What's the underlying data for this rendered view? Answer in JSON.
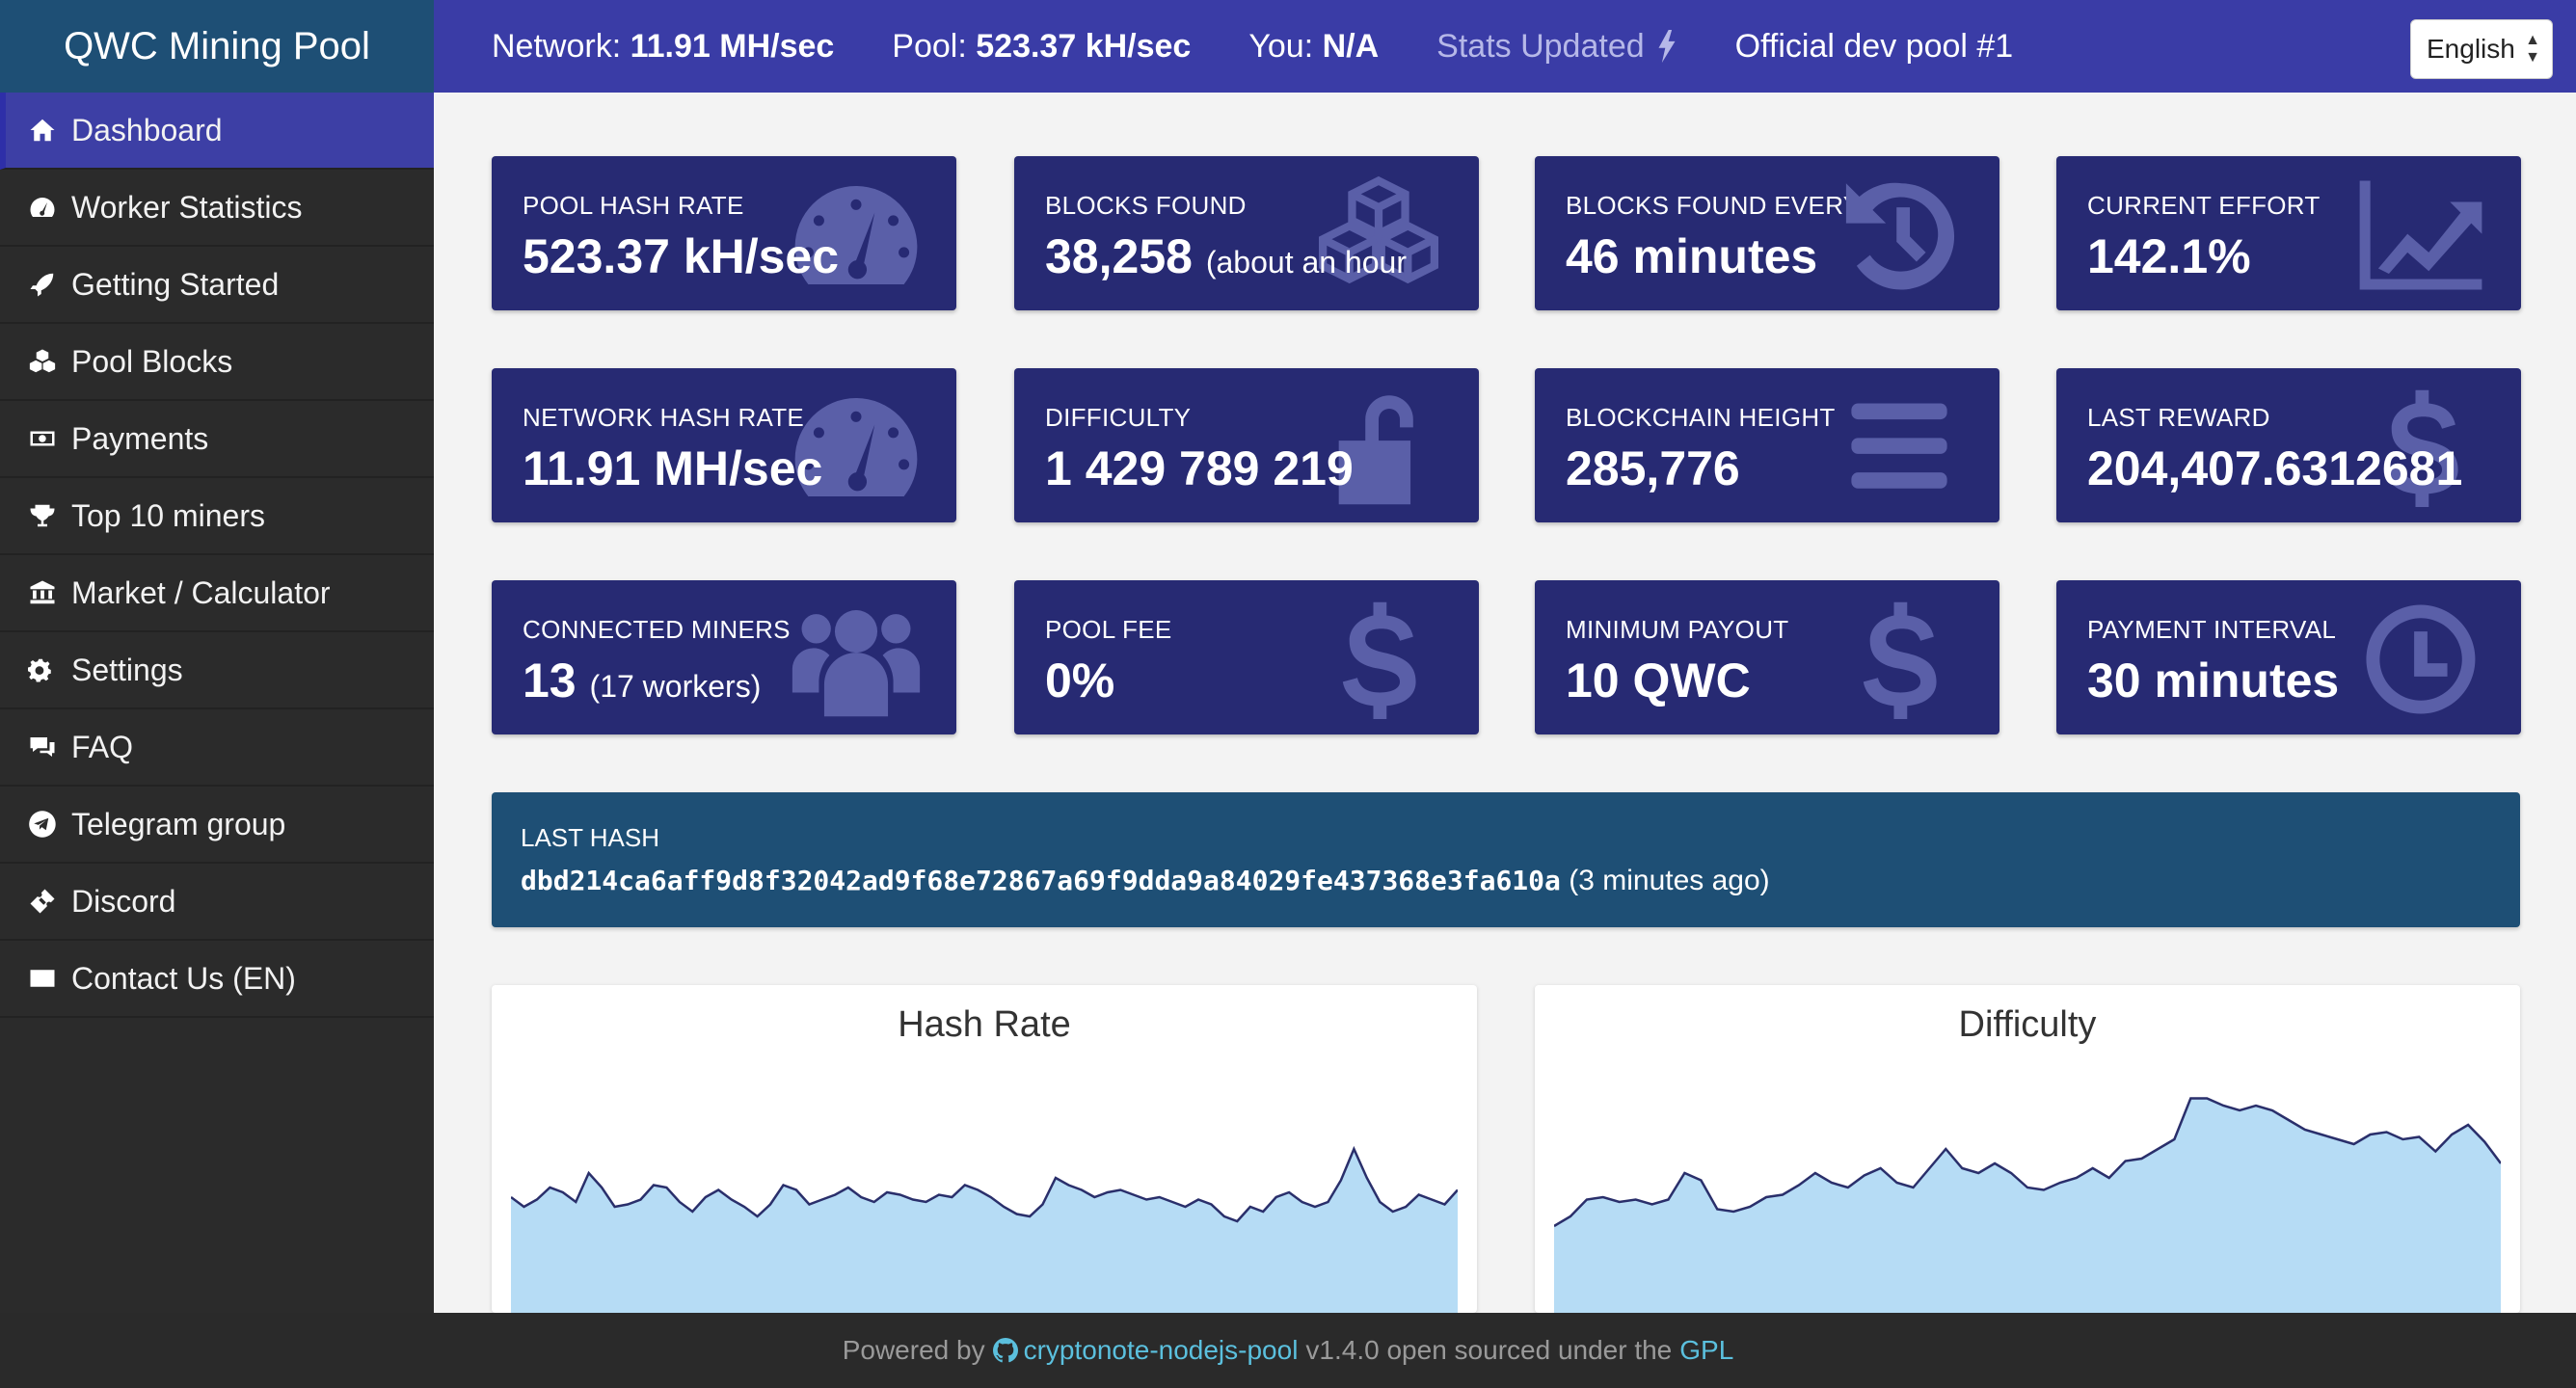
{
  "brand": "QWC Mining Pool",
  "nav": [
    {
      "label": "Dashboard",
      "icon": "home-icon",
      "active": true
    },
    {
      "label": "Worker Statistics",
      "icon": "tachometer-icon"
    },
    {
      "label": "Getting Started",
      "icon": "rocket-icon"
    },
    {
      "label": "Pool Blocks",
      "icon": "cubes-icon"
    },
    {
      "label": "Payments",
      "icon": "money-icon"
    },
    {
      "label": "Top 10 miners",
      "icon": "trophy-icon"
    },
    {
      "label": "Market / Calculator",
      "icon": "bank-icon"
    },
    {
      "label": "Settings",
      "icon": "gears-icon"
    },
    {
      "label": "FAQ",
      "icon": "comments-icon"
    },
    {
      "label": "Telegram group",
      "icon": "telegram-icon"
    },
    {
      "label": "Discord",
      "icon": "ticket-icon"
    },
    {
      "label": "Contact Us (EN)",
      "icon": "envelope-icon"
    }
  ],
  "topbar": {
    "network_label": "Network:",
    "network_value": "11.91 MH/sec",
    "pool_label": "Pool:",
    "pool_value": "523.37 kH/sec",
    "you_label": "You:",
    "you_value": "N/A",
    "stats_updated": "Stats Updated",
    "official": "Official dev pool #1",
    "language": "English"
  },
  "cards": {
    "pool_hash_rate": {
      "label": "POOL HASH RATE",
      "value": "523.37 kH/sec"
    },
    "blocks_found": {
      "label": "BLOCKS FOUND",
      "value": "38,258",
      "sub": "(about an hour"
    },
    "blocks_found_every": {
      "label": "BLOCKS FOUND EVERY",
      "value": "46 minutes"
    },
    "current_effort": {
      "label": "CURRENT EFFORT",
      "value": "142.1%"
    },
    "network_hash_rate": {
      "label": "NETWORK HASH RATE",
      "value": "11.91 MH/sec"
    },
    "difficulty": {
      "label": "DIFFICULTY",
      "value": "1 429 789 219"
    },
    "blockchain_height": {
      "label": "BLOCKCHAIN HEIGHT",
      "value": "285,776"
    },
    "last_reward": {
      "label": "LAST REWARD",
      "value": "204,407.6312681"
    },
    "connected_miners": {
      "label": "CONNECTED MINERS",
      "value": "13",
      "sub": "(17 workers)"
    },
    "pool_fee": {
      "label": "POOL FEE",
      "value": "0%"
    },
    "minimum_payout": {
      "label": "MINIMUM PAYOUT",
      "value": "10 QWC"
    },
    "payment_interval": {
      "label": "PAYMENT INTERVAL",
      "value": "30 minutes"
    }
  },
  "last_hash": {
    "label": "LAST HASH",
    "hash": "dbd214ca6aff9d8f32042ad9f68e72867a69f9dda9a84029fe437368e3fa610a",
    "ago": "(3 minutes ago)"
  },
  "charts": {
    "hashrate_title": "Hash Rate",
    "difficulty_title": "Difficulty",
    "fill_color": "#b6dcf5",
    "line_color": "#2a2f6b"
  },
  "chart_data": [
    {
      "type": "area",
      "title": "Hash Rate",
      "values": [
        48,
        44,
        47,
        52,
        50,
        46,
        58,
        52,
        44,
        45,
        47,
        53,
        52,
        46,
        42,
        48,
        51,
        47,
        44,
        40,
        45,
        53,
        51,
        45,
        47,
        49,
        52,
        48,
        46,
        50,
        49,
        47,
        46,
        49,
        48,
        53,
        51,
        48,
        44,
        41,
        40,
        45,
        56,
        53,
        51,
        48,
        50,
        51,
        49,
        47,
        48,
        46,
        44,
        47,
        45,
        40,
        38,
        44,
        42,
        48,
        50,
        46,
        44,
        46,
        55,
        68,
        56,
        46,
        42,
        44,
        49,
        47,
        45,
        51
      ]
    },
    {
      "type": "area",
      "title": "Difficulty",
      "values": [
        36,
        40,
        47,
        48,
        46,
        47,
        45,
        47,
        58,
        55,
        43,
        42,
        44,
        48,
        49,
        53,
        58,
        54,
        52,
        57,
        60,
        54,
        52,
        60,
        68,
        60,
        58,
        62,
        58,
        52,
        51,
        54,
        56,
        60,
        56,
        63,
        64,
        68,
        72,
        89,
        89,
        86,
        84,
        86,
        84,
        80,
        76,
        74,
        72,
        70,
        74,
        75,
        72,
        73,
        67,
        74,
        78,
        71,
        62
      ]
    }
  ],
  "footer": {
    "powered_by": "Powered by",
    "project": "cryptonote-nodejs-pool",
    "version_text": "v1.4.0 open sourced under the",
    "license": "GPL"
  }
}
